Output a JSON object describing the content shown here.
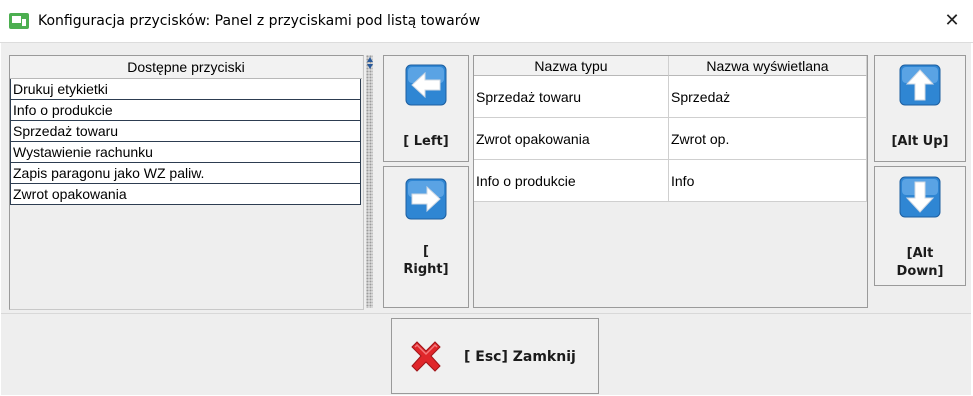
{
  "window": {
    "title": "Konfiguracja przycisków: Panel z przyciskami pod listą towarów",
    "close_symbol": "✕",
    "app_icon": "window-config-icon",
    "accent_color": "#4caf50"
  },
  "available_list": {
    "header": "Dostępne przyciski",
    "items": [
      "Drukuj etykietki",
      "Info o produkcie",
      "Sprzedaż towaru",
      "Wystawienie rachunku",
      "Zapis paragonu jako WZ paliw.",
      "Zwrot opakowania"
    ]
  },
  "move_buttons": {
    "left": {
      "label": "[ Left]",
      "icon": "arrow-left-icon"
    },
    "right": {
      "label_line1": "[",
      "label_line2": "Right]",
      "icon": "arrow-right-icon"
    }
  },
  "selected_table": {
    "columns": [
      "Nazwa typu",
      "Nazwa wyświetlana"
    ],
    "rows": [
      [
        "Sprzedaż towaru",
        "Sprzedaż"
      ],
      [
        "Zwrot opakowania",
        "Zwrot op."
      ],
      [
        "Info o produkcie",
        "Info"
      ]
    ]
  },
  "order_buttons": {
    "up": {
      "label": "[Alt Up]",
      "icon": "arrow-up-icon"
    },
    "down": {
      "label_line1": "[Alt",
      "label_line2": "Down]",
      "icon": "arrow-down-icon"
    }
  },
  "footer": {
    "close_label": "[ Esc] Zamknij",
    "close_icon": "red-x-icon"
  },
  "colors": {
    "arrow_blue": "#2f86d3",
    "close_red": "#e0262a",
    "row_border": "#2d3d51"
  }
}
